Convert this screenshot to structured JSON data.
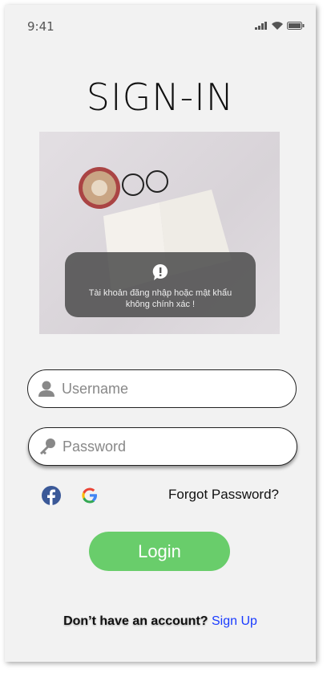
{
  "status_bar": {
    "time": "9:41"
  },
  "title": "SIGN-IN",
  "toast": {
    "message": "Tài khoản đăng nhập hoặc mật khẩu không chính xác !",
    "icon": "alert-bubble-icon"
  },
  "username": {
    "placeholder": "Username",
    "icon": "user-icon"
  },
  "password": {
    "placeholder": "Password",
    "icon": "key-icon"
  },
  "social": {
    "facebook": "facebook-icon",
    "google": "google-icon"
  },
  "forgot_label": "Forgot Password?",
  "login_label": "Login",
  "signup": {
    "prompt": "Don’t have an account?",
    "link": "Sign Up"
  },
  "colors": {
    "login": "#69cd6b",
    "link": "#1a3cff",
    "facebook": "#3b5998"
  }
}
